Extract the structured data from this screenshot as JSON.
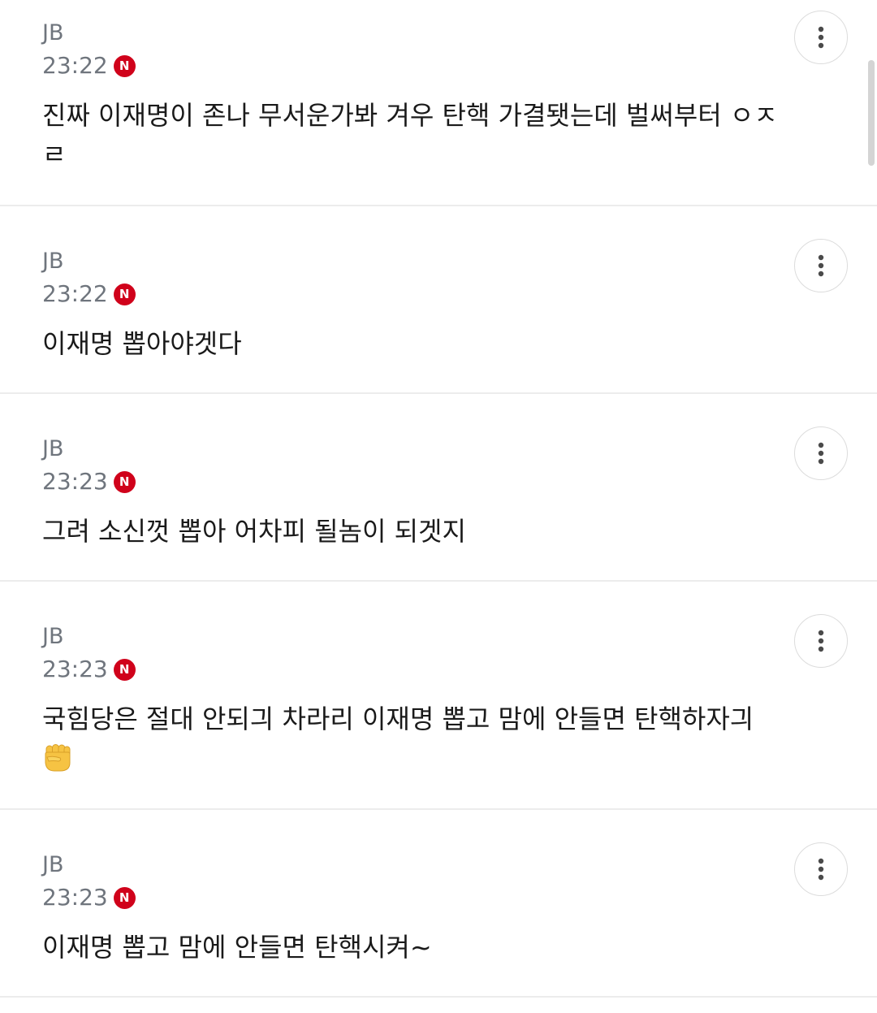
{
  "comments": [
    {
      "author": "JB",
      "time": "23:22",
      "badge": "N",
      "text": "진짜 이재명이 존나 무서운가봐 겨우 탄핵 가결됏는데 벌써부터 ㅇㅈㄹ",
      "emoji": ""
    },
    {
      "author": "JB",
      "time": "23:22",
      "badge": "N",
      "text": "이재명 뽑아야겟다",
      "emoji": ""
    },
    {
      "author": "JB",
      "time": "23:23",
      "badge": "N",
      "text": "그려 소신껏 뽑아 어차피 될놈이 되겟지",
      "emoji": ""
    },
    {
      "author": "JB",
      "time": "23:23",
      "badge": "N",
      "text": "국힘당은 절대 안되긔 차라리 이재명 뽑고 맘에 안들면 탄핵하자긔",
      "emoji": "raised-fist-icon"
    },
    {
      "author": "JB",
      "time": "23:23",
      "badge": "N",
      "text": "이재명 뽑고 맘에 안들면 탄핵시켜~",
      "emoji": ""
    }
  ],
  "icons": {
    "more": "more-vertical-icon",
    "new_badge": "new-badge-icon"
  },
  "colors": {
    "badge": "#d0021b",
    "meta_text": "#6f757d",
    "body_text": "#1a1a1a",
    "divider": "#ececec"
  }
}
